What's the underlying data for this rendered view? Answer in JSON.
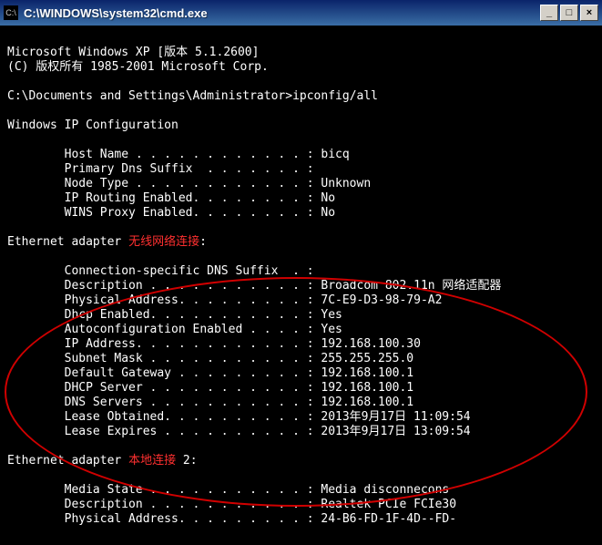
{
  "window": {
    "icon_glyph": "C:\\",
    "title": "C:\\WINDOWS\\system32\\cmd.exe"
  },
  "header": {
    "line1": "Microsoft Windows XP [版本 5.1.2600]",
    "line2": "(C) 版权所有 1985-2001 Microsoft Corp."
  },
  "prompt": {
    "path": "C:\\Documents and Settings\\Administrator>",
    "command": "ipconfig/all"
  },
  "sections": {
    "ipconfig_title": "Windows IP Configuration",
    "host_name": "        Host Name . . . . . . . . . . . . : bicq",
    "primary_dns": "        Primary Dns Suffix  . . . . . . . :",
    "node_type": "        Node Type . . . . . . . . . . . . : Unknown",
    "ip_routing": "        IP Routing Enabled. . . . . . . . : No",
    "wins_proxy": "        WINS Proxy Enabled. . . . . . . . : No",
    "adapter1_prefix": "Ethernet adapter ",
    "adapter1_name": "无线网络连接",
    "adapter1_suffix": ":",
    "a1_conn_dns": "        Connection-specific DNS Suffix  . :",
    "a1_desc": "        Description . . . . . . . . . . . : Broadcom 802.11n 网络适配器",
    "a1_phys": "        Physical Address. . . . . . . . . : 7C-E9-D3-98-79-A2",
    "a1_dhcp": "        Dhcp Enabled. . . . . . . . . . . : Yes",
    "a1_autoconf": "        Autoconfiguration Enabled . . . . : Yes",
    "a1_ip": "        IP Address. . . . . . . . . . . . : 192.168.100.30",
    "a1_subnet": "        Subnet Mask . . . . . . . . . . . : 255.255.255.0",
    "a1_gateway": "        Default Gateway . . . . . . . . . : 192.168.100.1",
    "a1_dhcpserv": "        DHCP Server . . . . . . . . . . . : 192.168.100.1",
    "a1_dns": "        DNS Servers . . . . . . . . . . . : 192.168.100.1",
    "a1_lease_obt": "        Lease Obtained. . . . . . . . . . : 2013年9月17日 11:09:54",
    "a1_lease_exp": "        Lease Expires . . . . . . . . . . : 2013年9月17日 13:09:54",
    "adapter2_prefix": "Ethernet adapter ",
    "adapter2_name": "本地连接",
    "adapter2_suffix": " 2:",
    "a2_media": "        Media State . . . . . . . . . . . : Media disconnecons",
    "a2_desc": "        Description . . . . . . . . . . . : Realtek PCIe FCIe30",
    "a2_phys": "        Physical Address. . . . . . . . . : 24-B6-FD-1F-4D--FD-"
  },
  "btn": {
    "min": "_",
    "max": "□",
    "close": "×"
  }
}
